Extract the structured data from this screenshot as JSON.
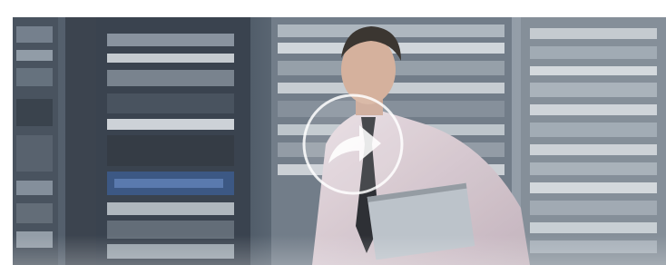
{
  "video": {
    "poster_description_icon": "server-room-man-with-laptop-image",
    "play_icon": "play-arrow-icon",
    "colors": {
      "overlay": "#ffffff",
      "rack_dark": "#2b3440",
      "rack_mid": "#5b6775",
      "shirt": "#d8c9d0"
    }
  }
}
